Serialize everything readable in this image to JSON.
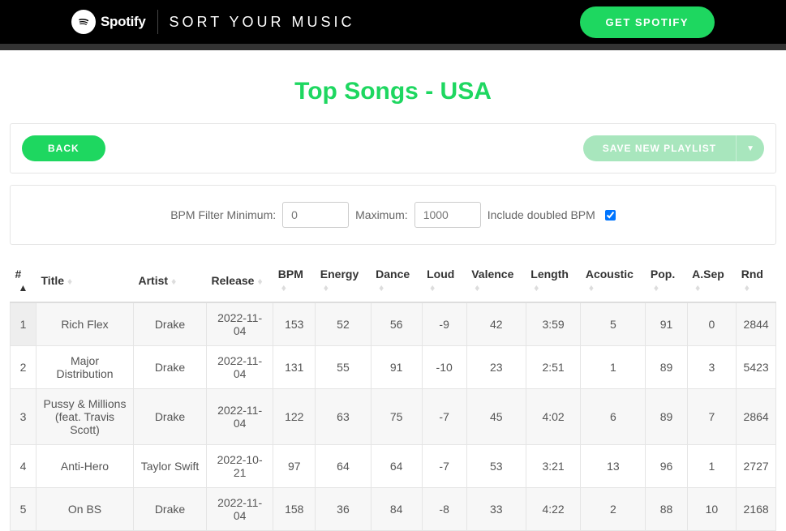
{
  "header": {
    "logo_text": "Spotify",
    "app_name": "SORT YOUR MUSIC",
    "get_spotify_label": "GET SPOTIFY"
  },
  "page_title": "Top Songs - USA",
  "toolbar": {
    "back_label": "BACK",
    "save_label": "SAVE NEW PLAYLIST"
  },
  "filters": {
    "min_label": "BPM Filter Minimum:",
    "min_placeholder": "0",
    "max_label": "Maximum:",
    "max_placeholder": "1000",
    "include_doubled_label": "Include doubled BPM",
    "include_doubled_checked": true
  },
  "table": {
    "columns": [
      {
        "key": "num",
        "label": "#",
        "sorted": "asc"
      },
      {
        "key": "title",
        "label": "Title"
      },
      {
        "key": "artist",
        "label": "Artist"
      },
      {
        "key": "release",
        "label": "Release"
      },
      {
        "key": "bpm",
        "label": "BPM"
      },
      {
        "key": "energy",
        "label": "Energy"
      },
      {
        "key": "dance",
        "label": "Dance"
      },
      {
        "key": "loud",
        "label": "Loud"
      },
      {
        "key": "valence",
        "label": "Valence"
      },
      {
        "key": "length",
        "label": "Length"
      },
      {
        "key": "acoustic",
        "label": "Acoustic"
      },
      {
        "key": "pop",
        "label": "Pop."
      },
      {
        "key": "asep",
        "label": "A.Sep"
      },
      {
        "key": "rnd",
        "label": "Rnd"
      }
    ],
    "rows": [
      {
        "num": "1",
        "title": "Rich Flex",
        "artist": "Drake",
        "release": "2022-11-04",
        "bpm": "153",
        "energy": "52",
        "dance": "56",
        "loud": "-9",
        "valence": "42",
        "length": "3:59",
        "acoustic": "5",
        "pop": "91",
        "asep": "0",
        "rnd": "2844"
      },
      {
        "num": "2",
        "title": "Major Distribution",
        "artist": "Drake",
        "release": "2022-11-04",
        "bpm": "131",
        "energy": "55",
        "dance": "91",
        "loud": "-10",
        "valence": "23",
        "length": "2:51",
        "acoustic": "1",
        "pop": "89",
        "asep": "3",
        "rnd": "5423"
      },
      {
        "num": "3",
        "title": "Pussy & Millions (feat. Travis Scott)",
        "artist": "Drake",
        "release": "2022-11-04",
        "bpm": "122",
        "energy": "63",
        "dance": "75",
        "loud": "-7",
        "valence": "45",
        "length": "4:02",
        "acoustic": "6",
        "pop": "89",
        "asep": "7",
        "rnd": "2864"
      },
      {
        "num": "4",
        "title": "Anti-Hero",
        "artist": "Taylor Swift",
        "release": "2022-10-21",
        "bpm": "97",
        "energy": "64",
        "dance": "64",
        "loud": "-7",
        "valence": "53",
        "length": "3:21",
        "acoustic": "13",
        "pop": "96",
        "asep": "1",
        "rnd": "2727"
      },
      {
        "num": "5",
        "title": "On BS",
        "artist": "Drake",
        "release": "2022-11-04",
        "bpm": "158",
        "energy": "36",
        "dance": "84",
        "loud": "-8",
        "valence": "33",
        "length": "4:22",
        "acoustic": "2",
        "pop": "88",
        "asep": "10",
        "rnd": "2168"
      }
    ]
  }
}
